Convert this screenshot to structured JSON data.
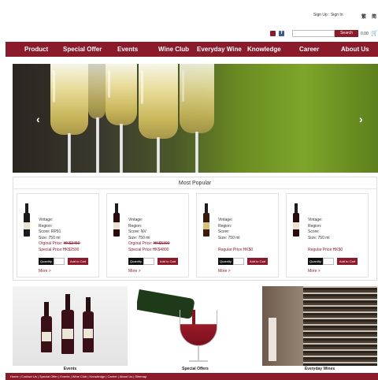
{
  "header": {
    "auth_links": "Sign Up : Sign In",
    "lang_1": "繁",
    "lang_2": "简",
    "search_button": "Search",
    "cart_total": "0.00"
  },
  "nav": {
    "items": [
      "Product",
      "Special Offer",
      "Events",
      "Wine Club",
      "Everyday Wine",
      "Knowledge",
      "Career",
      "About Us"
    ]
  },
  "slider": {
    "prev_icon": "‹",
    "next_icon": "›"
  },
  "popular": {
    "title": "Most Popular",
    "quantity_label": "Quantity",
    "add_label": "Add to Cart",
    "more_label": "More >",
    "products": [
      {
        "vintage": "Vintage:",
        "region": "Region:",
        "score": "Score: RP91",
        "size": "Size: 750 ml",
        "original_prefix": "Orginal Price: ",
        "original_price": "HK$3450",
        "special": "Special Price:HK$2500"
      },
      {
        "vintage": "Vintage:",
        "region": "Region:",
        "score": "Score: NV",
        "size": "Size: 750 ml",
        "original_prefix": "Orginal Price: ",
        "original_price": "HK$5300",
        "special": "Special Price:HK$4800"
      },
      {
        "vintage": "Vintage:",
        "region": "Region:",
        "score": "Score:",
        "size": "Size: 750 ml",
        "regular": "Regular Price:HK$0"
      },
      {
        "vintage": "Vintage:",
        "region": "Region:",
        "score": "Score:",
        "size": "Size: 750 ml",
        "regular": "Regular Price:HK$0"
      }
    ]
  },
  "promos": {
    "events": "Events",
    "special_offers": "Special Offers",
    "everyday_wines": "Everyday Wines"
  },
  "footer": {
    "links": "Home | Contact Us | Special Offer | Events | Wine Club | Knowledge | Career | About Us | Sitemap"
  },
  "colors": {
    "brand": "#8b1a2a"
  }
}
